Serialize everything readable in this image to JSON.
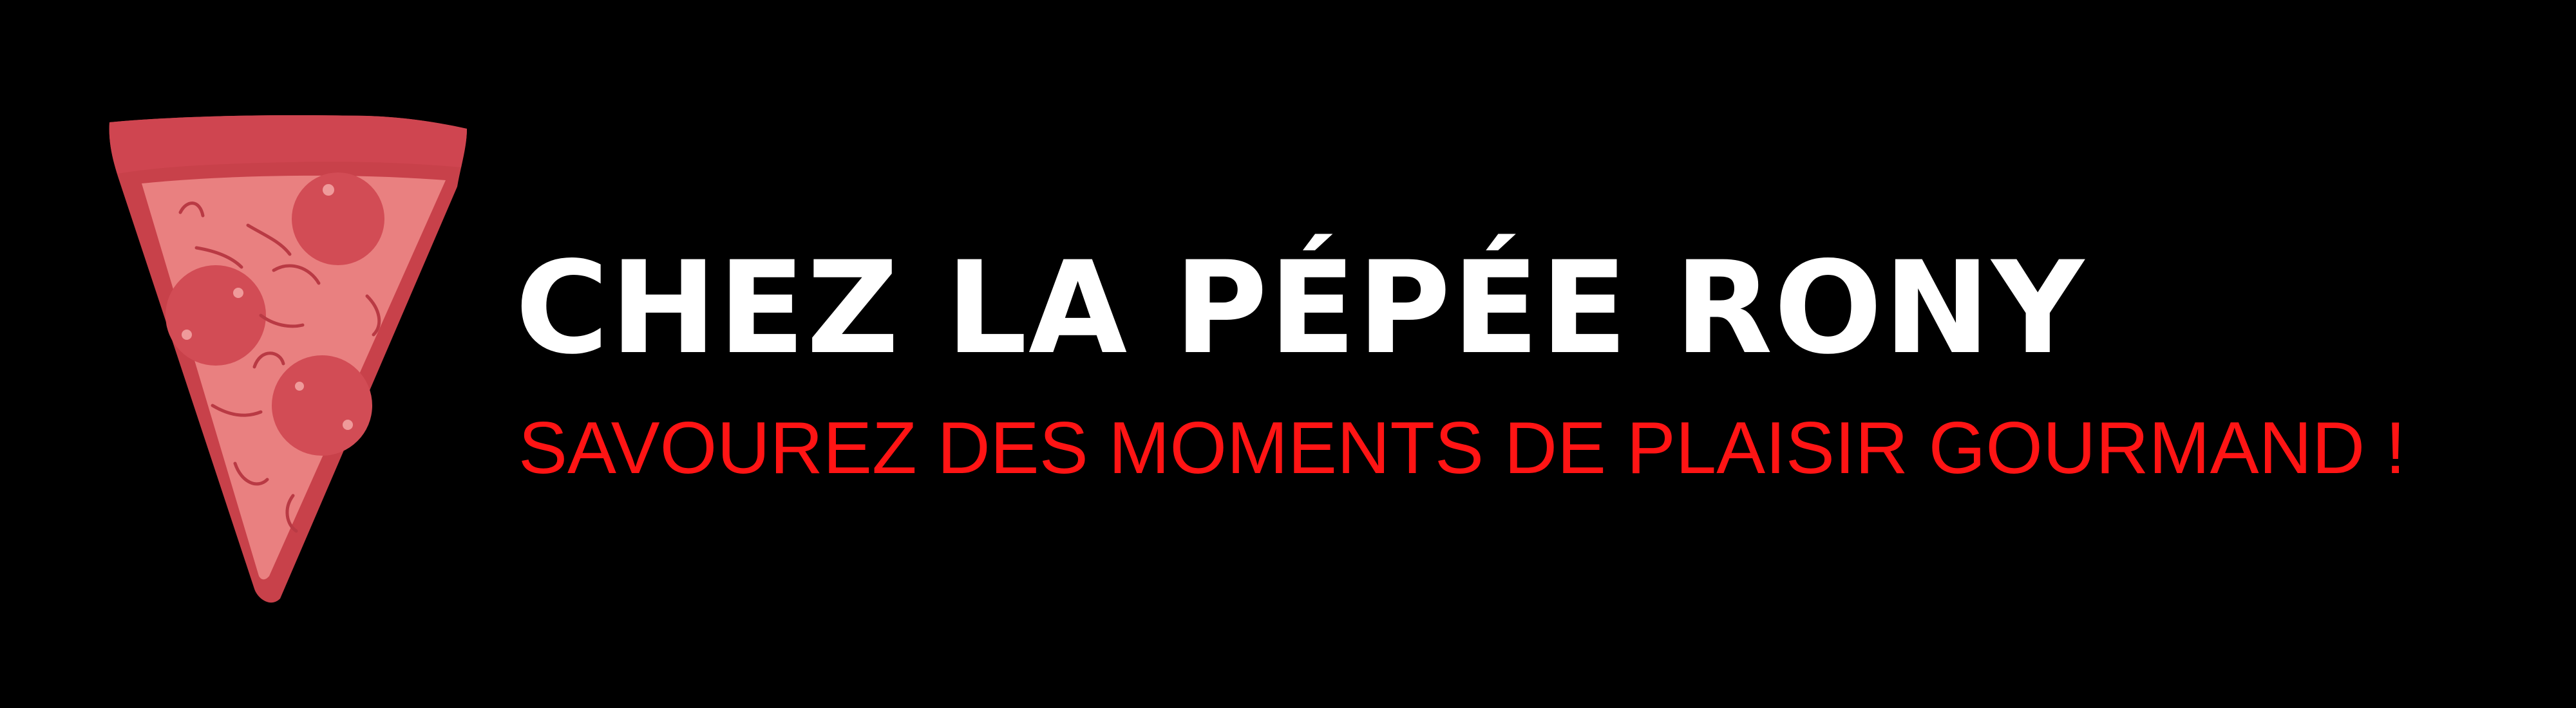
{
  "brand": {
    "name": "CHEZ LA PÉPÉE RONY",
    "tagline": "SAVOUREZ DES MOMENTS DE PLAISIR GOURMAND !",
    "logo_icon": "pizza-slice-icon"
  },
  "colors": {
    "background": "#000000",
    "title": "#ffffff",
    "tagline": "#ff1414",
    "crust": "#c8414a",
    "cheese": "#e98080",
    "pepperoni": "#d24c55"
  }
}
